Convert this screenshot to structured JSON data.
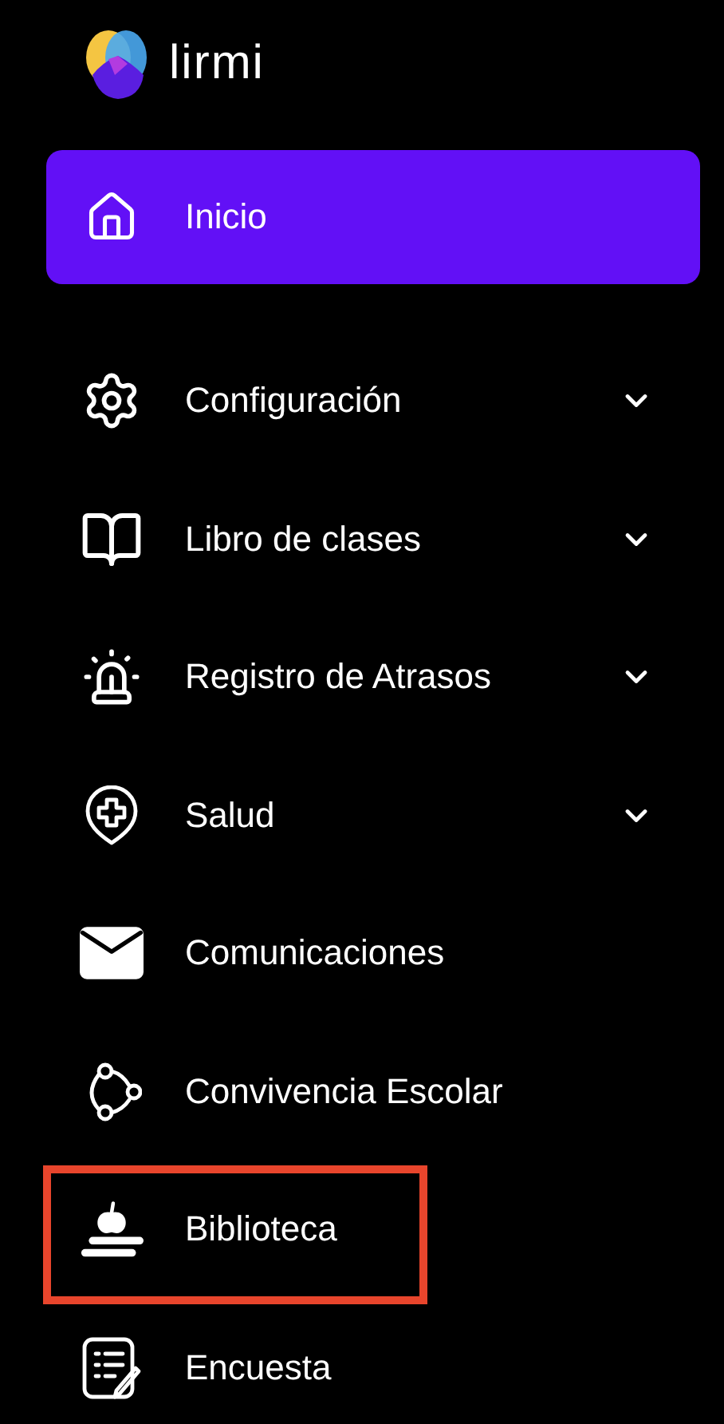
{
  "brand": {
    "name": "lirmi"
  },
  "nav": [
    {
      "label": "Inicio",
      "selected": true,
      "expandable": false,
      "highlighted": false
    },
    {
      "label": "Configuración",
      "selected": false,
      "expandable": true,
      "highlighted": false
    },
    {
      "label": "Libro de clases",
      "selected": false,
      "expandable": true,
      "highlighted": false
    },
    {
      "label": "Registro de Atrasos",
      "selected": false,
      "expandable": true,
      "highlighted": false
    },
    {
      "label": "Salud",
      "selected": false,
      "expandable": true,
      "highlighted": false
    },
    {
      "label": "Comunicaciones",
      "selected": false,
      "expandable": false,
      "highlighted": false
    },
    {
      "label": "Convivencia Escolar",
      "selected": false,
      "expandable": false,
      "highlighted": false
    },
    {
      "label": "Biblioteca",
      "selected": false,
      "expandable": false,
      "highlighted": true
    },
    {
      "label": "Encuesta",
      "selected": false,
      "expandable": false,
      "highlighted": false
    }
  ]
}
